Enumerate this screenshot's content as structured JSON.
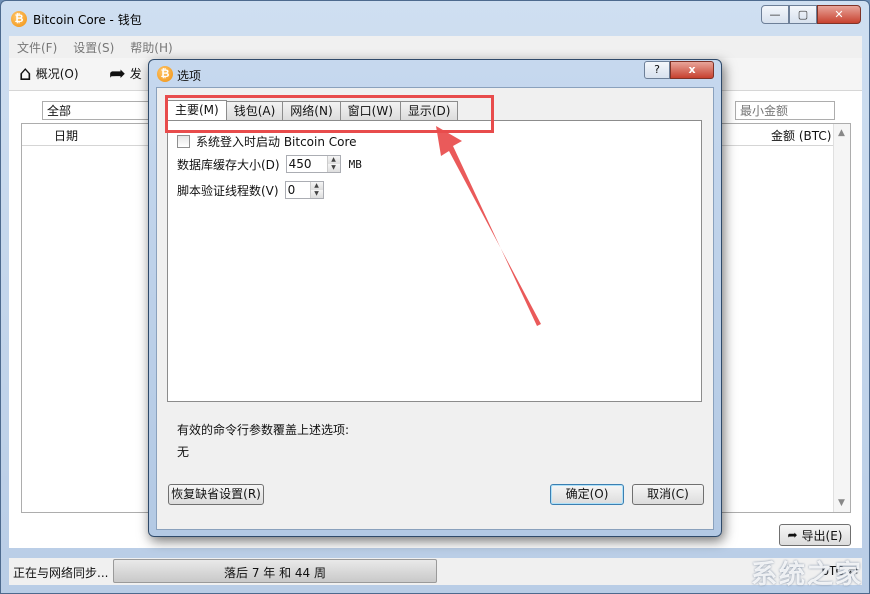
{
  "main_window": {
    "title": "Bitcoin Core - 钱包",
    "icon": "bitcoin-icon"
  },
  "menu": [
    "文件(F)",
    "设置(S)",
    "帮助(H)"
  ],
  "toolbar": {
    "overview_label": "概况(O)",
    "send_label": "发"
  },
  "filter": {
    "type_value": "全部",
    "min_amount_placeholder": "最小金额"
  },
  "table": {
    "col_date": "日期",
    "col_amount": "金额 (BTC)"
  },
  "export_label": "导出(E)",
  "status": {
    "sync_text": "正在与网络同步...",
    "progress_text": "落后 7 年 和 44 周",
    "progress_fraction": 0.0,
    "unit_text": "bTC"
  },
  "watermark": "系统之家",
  "dialog": {
    "title": "选项",
    "help_label": "?",
    "close_label": "x",
    "tabs": [
      {
        "label": "主要(M)",
        "active": true
      },
      {
        "label": "钱包(A)",
        "active": false
      },
      {
        "label": "网络(N)",
        "active": false
      },
      {
        "label": "窗口(W)",
        "active": false
      },
      {
        "label": "显示(D)",
        "active": false
      }
    ],
    "start_on_login_label": "系统登入时启动 Bitcoin Core",
    "start_on_login_checked": false,
    "db_cache_label": "数据库缓存大小(D)",
    "db_cache_value": "450",
    "db_cache_unit": "MB",
    "script_threads_label": "脚本验证线程数(V)",
    "script_threads_value": "0",
    "cmdline_note": "有效的命令行参数覆盖上述选项:",
    "cmdline_value": "无",
    "reset_label": "恢复缺省设置(R)",
    "ok_label": "确定(O)",
    "cancel_label": "取消(C)"
  },
  "annotation_color": "#e84c4c"
}
